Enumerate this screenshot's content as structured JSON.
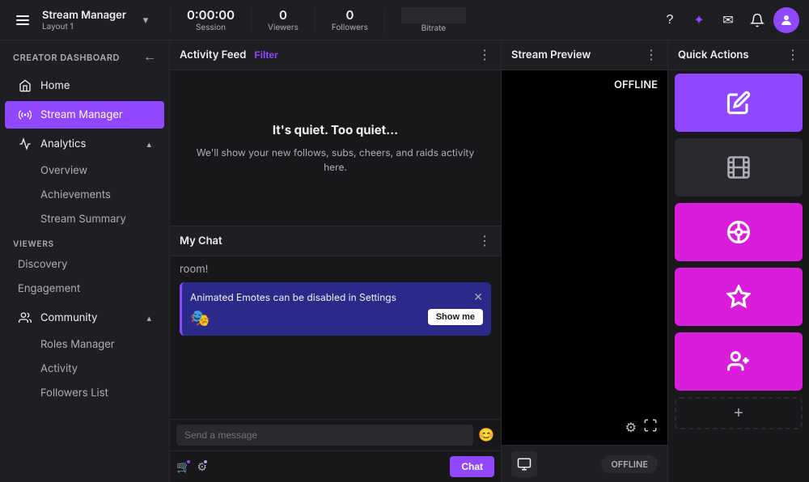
{
  "topnav": {
    "hamburger_label": "menu",
    "app_title": "Stream Manager",
    "app_layout": "Layout 1",
    "chevron_label": "expand",
    "session_time": "0:00:00",
    "session_label": "Session",
    "viewers_value": "0",
    "viewers_label": "Viewers",
    "followers_value": "0",
    "followers_label": "Followers",
    "bitrate_label": "Bitrate",
    "help_icon": "?",
    "extensions_icon": "✦",
    "messages_icon": "✉",
    "notifications_icon": "🔔",
    "avatar_label": "Profile"
  },
  "sidebar": {
    "header_title": "CREATOR DASHBOARD",
    "back_icon": "←",
    "nav_items": [
      {
        "id": "home",
        "label": "Home",
        "icon": "🏠",
        "active": false
      },
      {
        "id": "stream-manager",
        "label": "Stream Manager",
        "icon": "📡",
        "active": true
      },
      {
        "id": "analytics",
        "label": "Analytics",
        "icon": "📊",
        "active": false,
        "has_chevron": true
      }
    ],
    "analytics_sub": [
      {
        "id": "overview",
        "label": "Overview"
      },
      {
        "id": "achievements",
        "label": "Achievements"
      },
      {
        "id": "stream-summary",
        "label": "Stream Summary"
      }
    ],
    "viewers_section": "VIEWERS",
    "viewers_items": [
      {
        "id": "discovery",
        "label": "Discovery"
      },
      {
        "id": "engagement",
        "label": "Engagement"
      }
    ],
    "community_item": {
      "id": "community",
      "label": "Community",
      "icon": "👥",
      "has_chevron": true
    },
    "community_sub": [
      {
        "id": "roles-manager",
        "label": "Roles Manager"
      },
      {
        "id": "activity",
        "label": "Activity"
      },
      {
        "id": "followers-list",
        "label": "Followers List"
      }
    ]
  },
  "activity_feed": {
    "title": "Activity Feed",
    "filter_label": "Filter",
    "menu_icon": "⋮",
    "quiet_title": "It's quiet. Too quiet...",
    "quiet_desc": "We'll show your new follows, subs, cheers, and raids activity here."
  },
  "chat_panel": {
    "title": "My Chat",
    "menu_icon": "⋮",
    "message_text": "room!",
    "notification_text": "Animated Emotes can be disabled in Settings",
    "show_me_label": "Show me",
    "close_icon": "✕",
    "emote_icon": "🎭",
    "input_placeholder": "Send a message",
    "emoji_icon": "😊",
    "send_label": "Chat"
  },
  "stream_preview": {
    "title": "Stream Preview",
    "menu_icon": "⋮",
    "offline_label": "OFFLINE",
    "settings_icon": "⚙",
    "expand_icon": "⛶",
    "thumb_icon": "🎬",
    "offline_pill": "OFFLINE"
  },
  "quick_actions": {
    "title": "Quick Actions",
    "menu_icon": "⋮",
    "buttons": [
      {
        "id": "edit",
        "icon": "✏",
        "color": "purple",
        "label": "Edit"
      },
      {
        "id": "clip",
        "icon": "🎞",
        "color": "dark",
        "label": "Clip"
      },
      {
        "id": "wheel",
        "icon": "◎",
        "color": "pink",
        "label": "Wheel"
      },
      {
        "id": "star",
        "icon": "☆",
        "color": "pink2",
        "label": "Star"
      },
      {
        "id": "add-user",
        "icon": "👤+",
        "color": "pink3",
        "label": "Add User"
      }
    ],
    "add_icon": "+"
  }
}
